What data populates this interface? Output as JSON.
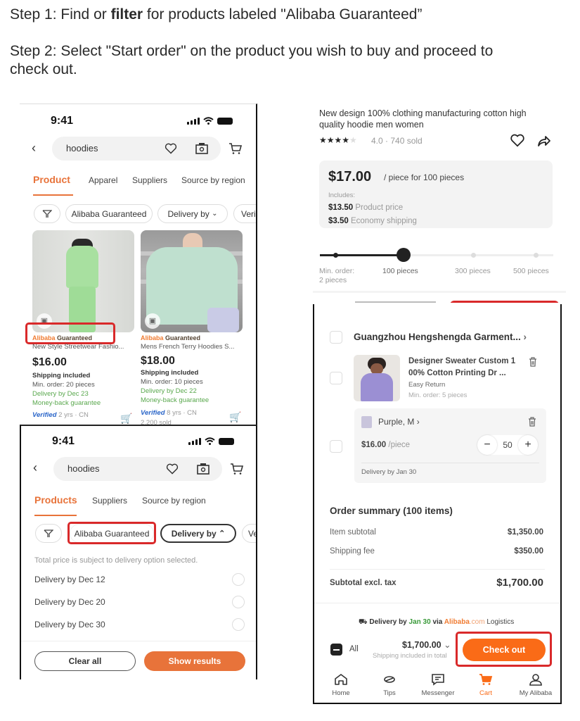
{
  "instructions": {
    "step1_prefix": "Step 1: Find or ",
    "step1_bold": "filter",
    "step1_suffix": " for products labeled \"Alibaba Guaranteed”",
    "step2_line1": "Step 2: Select \"Start order\" on the product you wish to buy and proceed to",
    "step2_line2": "check out."
  },
  "colors": {
    "accent": "#e8733a",
    "highlight": "#d9292a",
    "green": "#5aa84e",
    "checkout": "#fa6b17"
  },
  "search_screen": {
    "time": "9:41",
    "search_value": "hoodies",
    "tabs": [
      "Product",
      "Apparel",
      "Suppliers",
      "Source by region"
    ],
    "active_tab": "Product",
    "chips": [
      "Alibaba Guaranteed",
      "Delivery by",
      "Veri"
    ],
    "products": [
      {
        "badge_orange": "Alibaba",
        "badge_dark": "Guaranteed",
        "name": "New Style Streetwear Fashio...",
        "price": "$16.00",
        "shipping": "Shipping included",
        "min_order": "Min. order: 20 pieces",
        "delivery": "Delivery by Dec 23",
        "guarantee": "Money-back guarantee",
        "verified": "Verified",
        "supplier_info": "2 yrs · CN"
      },
      {
        "badge_orange": "Alibaba",
        "badge_dark": "Guaranteed",
        "name": "Mens French Terry Hoodies S...",
        "price": "$18.00",
        "shipping": "Shipping included",
        "min_order": "Min. order: 10 pieces",
        "delivery": "Delivery by Dec 22",
        "guarantee": "Money-back guarantee",
        "verified": "Verified",
        "supplier_info": "8 yrs · CN",
        "sold": "2,200 sold"
      }
    ]
  },
  "filter_screen": {
    "time": "9:41",
    "search_value": "hoodies",
    "tabs": [
      "Products",
      "Suppliers",
      "Source by region"
    ],
    "active_tab": "Products",
    "chips": [
      "Alibaba Guaranteed",
      "Delivery by",
      "Ve"
    ],
    "note": "Total price is subject to delivery option selected.",
    "options": [
      "Delivery by Dec 12",
      "Delivery by Dec 20",
      "Delivery by Dec 30"
    ],
    "clear_label": "Clear all",
    "show_label": "Show results"
  },
  "product_detail": {
    "title_line1": "New design 100% clothing manufacturing cotton high",
    "title_line2": "quality hoodie men women",
    "rating": "4.0",
    "rating_stars": 4,
    "sold": "740 sold",
    "price": "$17.00",
    "price_unit": "/ piece for 100 pieces",
    "includes_label": "Includes:",
    "breakdown": [
      {
        "amount": "$13.50",
        "label": "Product price"
      },
      {
        "amount": "$3.50",
        "label": "Economy shipping"
      }
    ],
    "tiers": [
      "Min. order:\n2 pieces",
      "100 pieces",
      "300 pieces",
      "500 pieces"
    ],
    "tier_min_line1": "Min. order:",
    "tier_min_line2": "2 pieces",
    "selected_tier": "100 pieces"
  },
  "cart": {
    "supplier": "Guangzhou Hengshengda Garment...",
    "item_name_line1": "Designer Sweater Custom 1",
    "item_name_line2": "00% Cotton Printing Dr ...",
    "easy_return": "Easy Return",
    "min_order": "Min. order: 5 pieces",
    "variant": "Purple, M",
    "unit_price": "$16.00",
    "unit": "/piece",
    "quantity": "50",
    "delivery": "Delivery by Jan 30",
    "summary_title": "Order summary (100 items)",
    "summary_rows": [
      {
        "label": "Item subtotal",
        "value": "$1,350.00"
      },
      {
        "label": "Shipping fee",
        "value": "$350.00"
      }
    ],
    "subtotal_label": "Subtotal excl. tax",
    "subtotal_value": "$1,700.00",
    "delivery_prefix": "Delivery by ",
    "delivery_date": "Jan 30",
    "delivery_via": " via ",
    "logistics_brand": "Alibaba",
    "logistics_com": ".com",
    "logistics_suffix": " Logistics",
    "all_label": "All",
    "total": "$1,700.00",
    "total_note": "Shipping included in total",
    "checkout_label": "Check out",
    "nav": [
      "Home",
      "Tips",
      "Messenger",
      "Cart",
      "My Alibaba"
    ],
    "active_nav": "Cart"
  }
}
